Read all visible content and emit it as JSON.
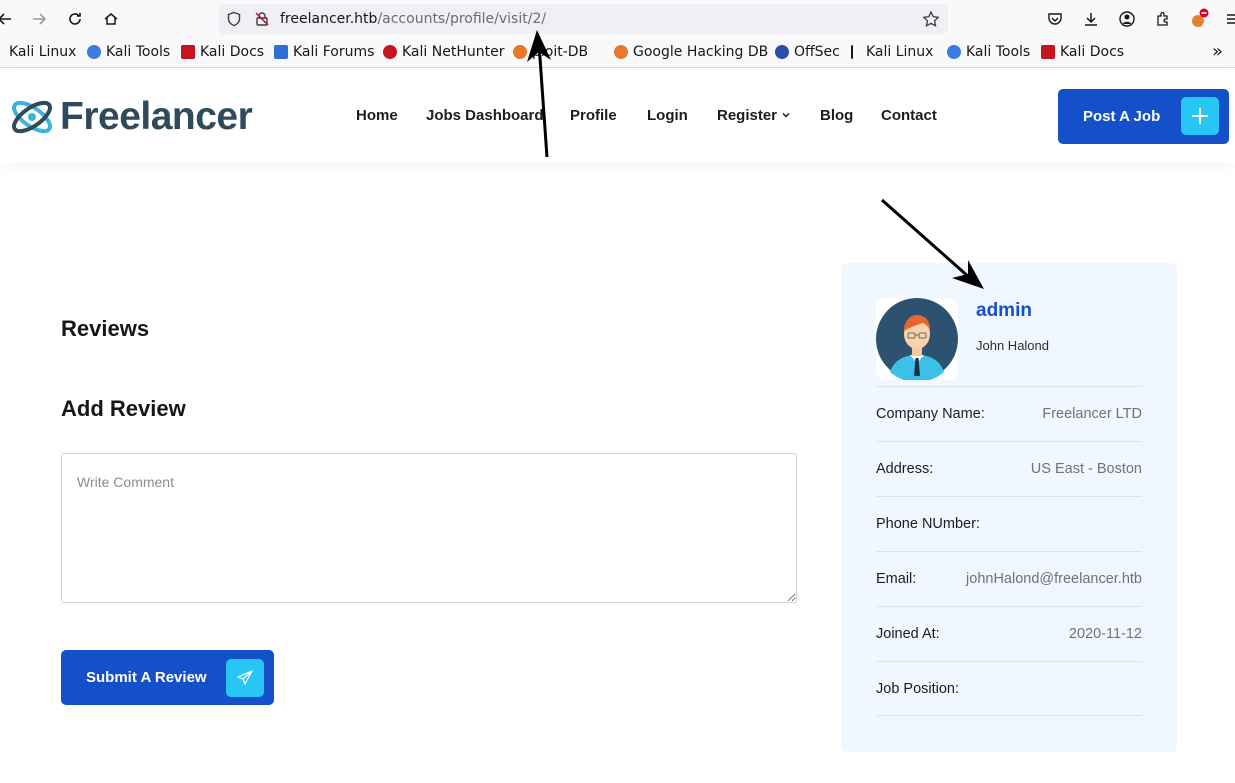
{
  "browser": {
    "url_host": "freelancer.htb",
    "url_path": "/accounts/profile/visit/2/",
    "bookmarks": [
      "Kali Linux",
      "Kali Tools",
      "Kali Docs",
      "Kali Forums",
      "Kali NetHunter",
      "ploit-DB",
      "Google Hacking DB",
      "OffSec",
      "Kali Linux",
      "Kali Tools",
      "Kali Docs"
    ]
  },
  "header": {
    "logo_text": "Freelancer",
    "menu": [
      "Home",
      "Jobs Dashboard",
      "Profile",
      "Login",
      "Register",
      "Blog",
      "Contact"
    ],
    "post_job_label": "Post A Job"
  },
  "content": {
    "reviews_title": "Reviews",
    "add_review_title": "Add Review",
    "comment_placeholder": "Write Comment",
    "submit_label": "Submit A Review"
  },
  "profile": {
    "username": "admin",
    "full_name": "John Halond",
    "fields": [
      {
        "label": "Company Name:",
        "value": "Freelancer LTD"
      },
      {
        "label": "Address:",
        "value": "US East - Boston"
      },
      {
        "label": "Phone NUmber:",
        "value": ""
      },
      {
        "label": "Email:",
        "value": "johnHalond@freelancer.htb"
      },
      {
        "label": "Joined At:",
        "value": "2020-11-12"
      },
      {
        "label": "Job Position:",
        "value": ""
      }
    ]
  },
  "colors": {
    "brand_blue": "#1350c9",
    "accent_cyan": "#27c6f5",
    "card_bg": "#f0f7fe"
  },
  "icons": [
    "back-arrow-icon",
    "forward-arrow-icon",
    "reload-icon",
    "home-icon",
    "shield-icon",
    "lock-slash-icon",
    "star-icon",
    "pocket-icon",
    "download-icon",
    "account-icon",
    "extensions-icon",
    "plus-icon",
    "paper-plane-icon"
  ]
}
